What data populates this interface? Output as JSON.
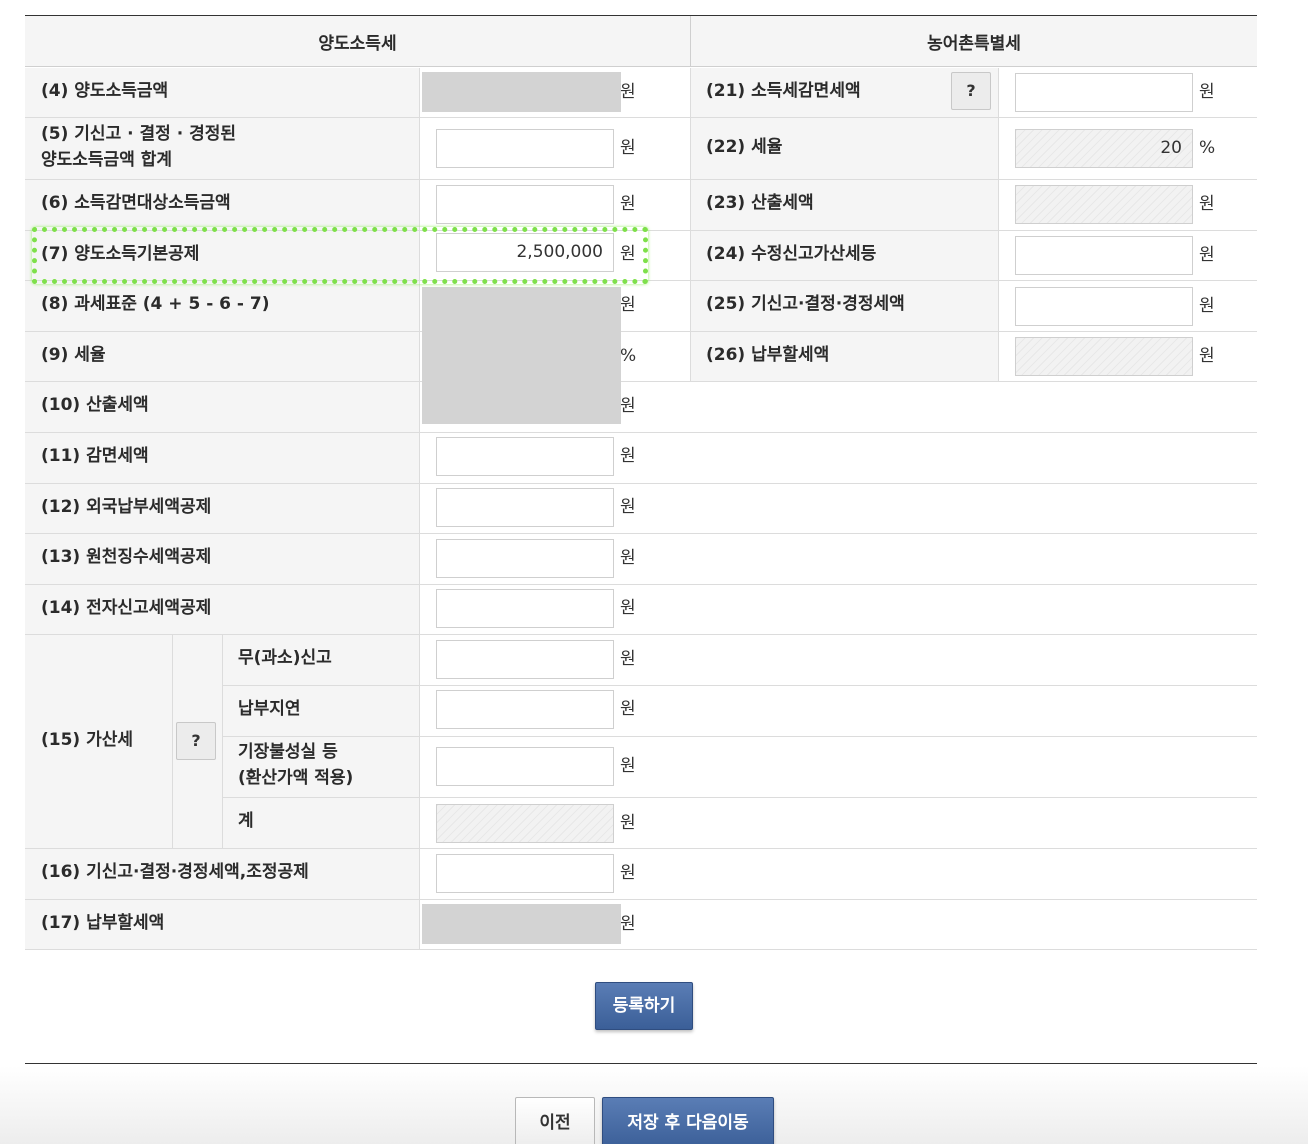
{
  "headers": {
    "left": "양도소득세",
    "right": "농어촌특별세"
  },
  "units": {
    "won": "원",
    "percent": "%"
  },
  "help_label": "?",
  "left_rows": [
    {
      "label": "(4) 양도소득금액",
      "value": ""
    },
    {
      "label_l1": "(5) 기신고 · 결정 · 경정된",
      "label_l2": "양도소득금액 합계",
      "value": ""
    },
    {
      "label": "(6) 소득감면대상소득금액",
      "value": ""
    },
    {
      "label": "(7) 양도소득기본공제",
      "value": "2,500,000"
    },
    {
      "label": "(8) 과세표준 (4 + 5 - 6 - 7)",
      "value": ""
    },
    {
      "label": "(9) 세율",
      "value": ""
    },
    {
      "label": "(10) 산출세액",
      "value": ""
    },
    {
      "label": "(11) 감면세액",
      "value": ""
    },
    {
      "label": "(12) 외국납부세액공제",
      "value": ""
    },
    {
      "label": "(13) 원천징수세액공제",
      "value": ""
    },
    {
      "label": "(14) 전자신고세액공제",
      "value": ""
    }
  ],
  "penalty": {
    "label": "(15) 가산세",
    "items": [
      {
        "label": "무(과소)신고",
        "value": ""
      },
      {
        "label": "납부지연",
        "value": ""
      },
      {
        "label_l1": "기장불성실 등",
        "label_l2": "(환산가액 적용)",
        "value": ""
      },
      {
        "label": "계",
        "value": ""
      }
    ]
  },
  "row16": {
    "label": "(16) 기신고·결정·경정세액,조정공제",
    "value": ""
  },
  "row17": {
    "label": "(17) 납부할세액",
    "value": ""
  },
  "right_rows": [
    {
      "label": "(21) 소득세감면세액",
      "value": ""
    },
    {
      "label": "(22) 세율",
      "value": "20"
    },
    {
      "label": "(23) 산출세액",
      "value": ""
    },
    {
      "label": "(24) 수정신고가산세등",
      "value": ""
    },
    {
      "label": "(25) 기신고·결정·경정세액",
      "value": ""
    },
    {
      "label": "(26) 납부할세액",
      "value": ""
    }
  ],
  "buttons": {
    "register": "등록하기",
    "prev": "이전",
    "save_next": "저장 후 다음이동"
  },
  "colors": {
    "highlight": "#7ee04a",
    "primary": "#3b5f98",
    "label_bg": "#f5f5f5",
    "redaction": "#d3d3d3"
  }
}
